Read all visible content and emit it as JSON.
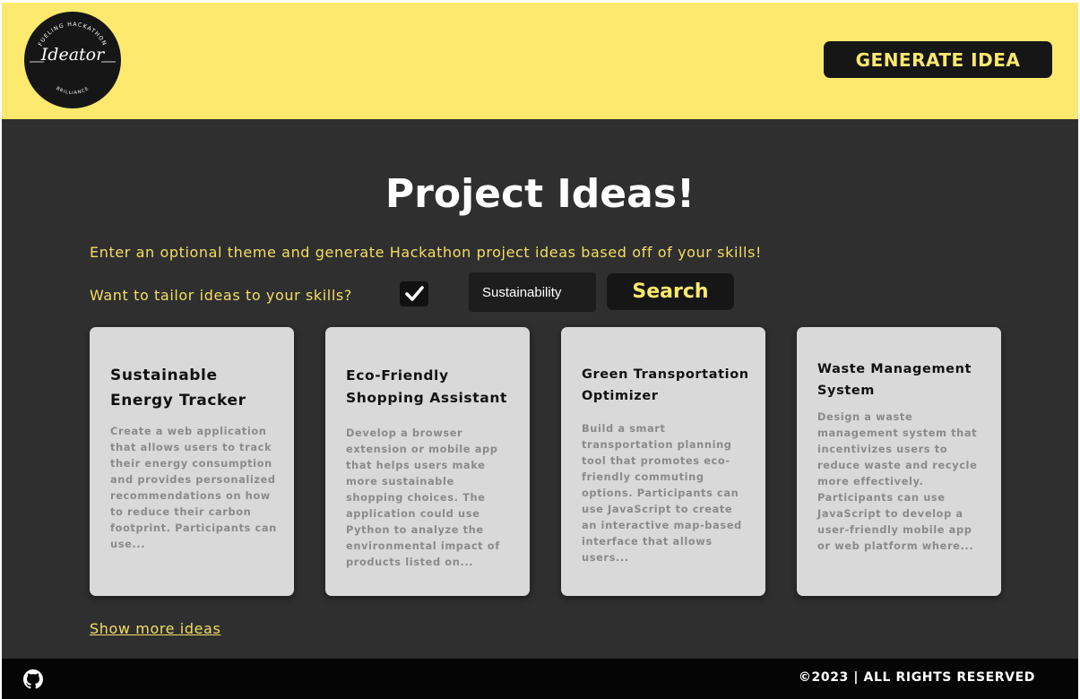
{
  "header": {
    "logo": {
      "wordmark": "Ideator",
      "arc_top": "FUELING HACKATHON",
      "arc_bottom": "BRILLIANCE"
    },
    "generate_button": "GENERATE IDEA"
  },
  "main": {
    "title": "Project Ideas!",
    "subtitle": "Enter an optional theme and generate Hackathon project ideas based off of your skills!",
    "tailor_label": "Want to tailor ideas to your skills?",
    "tailor_checked": true,
    "theme_input_value": "Sustainability",
    "search_button": "Search",
    "cards": [
      {
        "title": "Sustainable Energy Tracker",
        "description": "Create a web application that allows users to track their energy consumption and provides personalized recommendations on how to reduce their carbon footprint. Participants can use..."
      },
      {
        "title": "Eco-Friendly Shopping Assistant",
        "description": "Develop a browser extension or mobile app that helps users make more sustainable shopping choices. The application could use Python to analyze the environmental impact of products listed on..."
      },
      {
        "title": "Green Transportation Optimizer",
        "description": "Build a smart transportation planning tool that promotes eco-friendly commuting options. Participants can use JavaScript to create an interactive map-based interface that allows users..."
      },
      {
        "title": "Waste Management System",
        "description": "Design a waste management system that incentivizes users to reduce waste and recycle more effectively. Participants can use JavaScript to develop a user-friendly mobile app or web platform where..."
      }
    ],
    "show_more": "Show more ideas"
  },
  "footer": {
    "github_icon": "github-icon",
    "copyright": "©2023 | ALL RIGHTS RESERVED"
  },
  "colors": {
    "accent_yellow": "#fde96d",
    "text_yellow": "#f3de62",
    "background_dark": "#2f2f30",
    "card_background": "#d9d9d9",
    "footer_black": "#050505"
  }
}
